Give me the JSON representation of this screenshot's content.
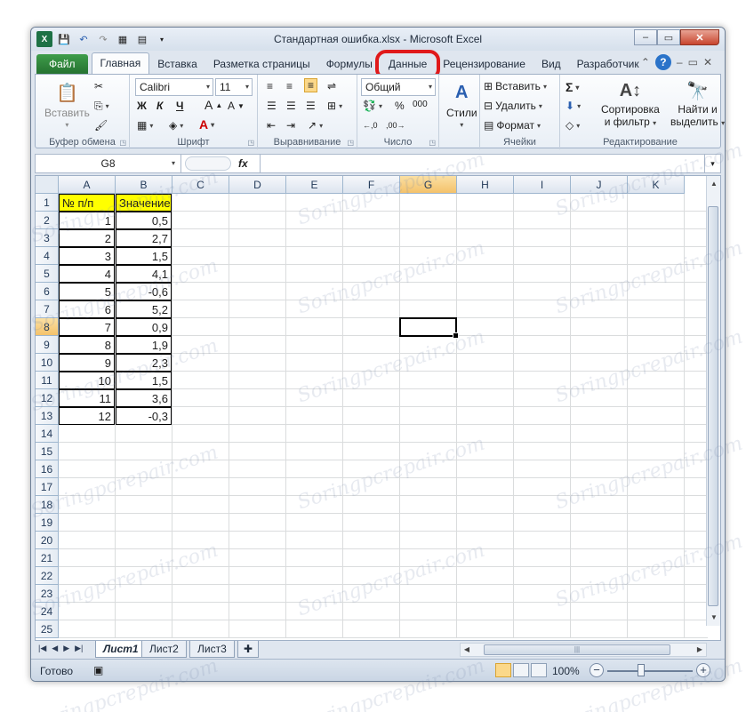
{
  "window": {
    "title": "Стандартная ошибка.xlsx  -  Microsoft Excel",
    "app_icon": "X",
    "controls": [
      "–",
      "▭",
      "✕"
    ]
  },
  "ribbon_tabs": [
    {
      "label": "Файл"
    },
    {
      "label": "Главная"
    },
    {
      "label": "Вставка"
    },
    {
      "label": "Разметка страницы"
    },
    {
      "label": "Формулы"
    },
    {
      "label": "Данные"
    },
    {
      "label": "Рецензирование"
    },
    {
      "label": "Вид"
    },
    {
      "label": "Разработчик"
    }
  ],
  "ribbon": {
    "clipboard": {
      "paste": "Вставить",
      "label": "Буфер обмена"
    },
    "font": {
      "name": "Calibri",
      "size": "11",
      "bold": "Ж",
      "italic": "К",
      "underline": "Ч",
      "label": "Шрифт"
    },
    "alignment": {
      "label": "Выравнивание"
    },
    "number": {
      "format": "Общий",
      "percent": "%",
      "thousands": "000",
      "label": "Число"
    },
    "styles": {
      "label": "Стили"
    },
    "cells": {
      "insert": "Вставить",
      "delete": "Удалить",
      "format": "Формат",
      "label": "Ячейки"
    },
    "editing": {
      "sort_line1": "Сортировка",
      "sort_line2": "и фильтр",
      "find_line1": "Найти и",
      "find_line2": "выделить",
      "label": "Редактирование"
    }
  },
  "formula_bar": {
    "name_box": "G8",
    "fx": "fx",
    "value": ""
  },
  "columns": [
    "A",
    "B",
    "C",
    "D",
    "E",
    "F",
    "G",
    "H",
    "I",
    "J",
    "K"
  ],
  "rows": [
    "1",
    "2",
    "3",
    "4",
    "5",
    "6",
    "7",
    "8",
    "9",
    "10",
    "11",
    "12",
    "13",
    "14",
    "15",
    "16",
    "17",
    "18",
    "19",
    "20",
    "21",
    "22",
    "23",
    "24",
    "25"
  ],
  "table": {
    "headers": [
      "№ п/п",
      "Значение"
    ],
    "values": [
      [
        "1",
        "0,5"
      ],
      [
        "2",
        "2,7"
      ],
      [
        "3",
        "1,5"
      ],
      [
        "4",
        "4,1"
      ],
      [
        "5",
        "-0,6"
      ],
      [
        "6",
        "5,2"
      ],
      [
        "7",
        "0,9"
      ],
      [
        "8",
        "1,9"
      ],
      [
        "9",
        "2,3"
      ],
      [
        "10",
        "1,5"
      ],
      [
        "11",
        "3,6"
      ],
      [
        "12",
        "-0,3"
      ]
    ]
  },
  "sheets": [
    "Лист1",
    "Лист2",
    "Лист3"
  ],
  "status": {
    "text": "Готово",
    "zoom": "100%"
  },
  "watermark": "Soringpcrepair.com",
  "colors": {
    "file_tab": "#257231",
    "highlight": "#e0191a",
    "header_fill": "#ffff00",
    "selected_header": "#f4c26b"
  }
}
